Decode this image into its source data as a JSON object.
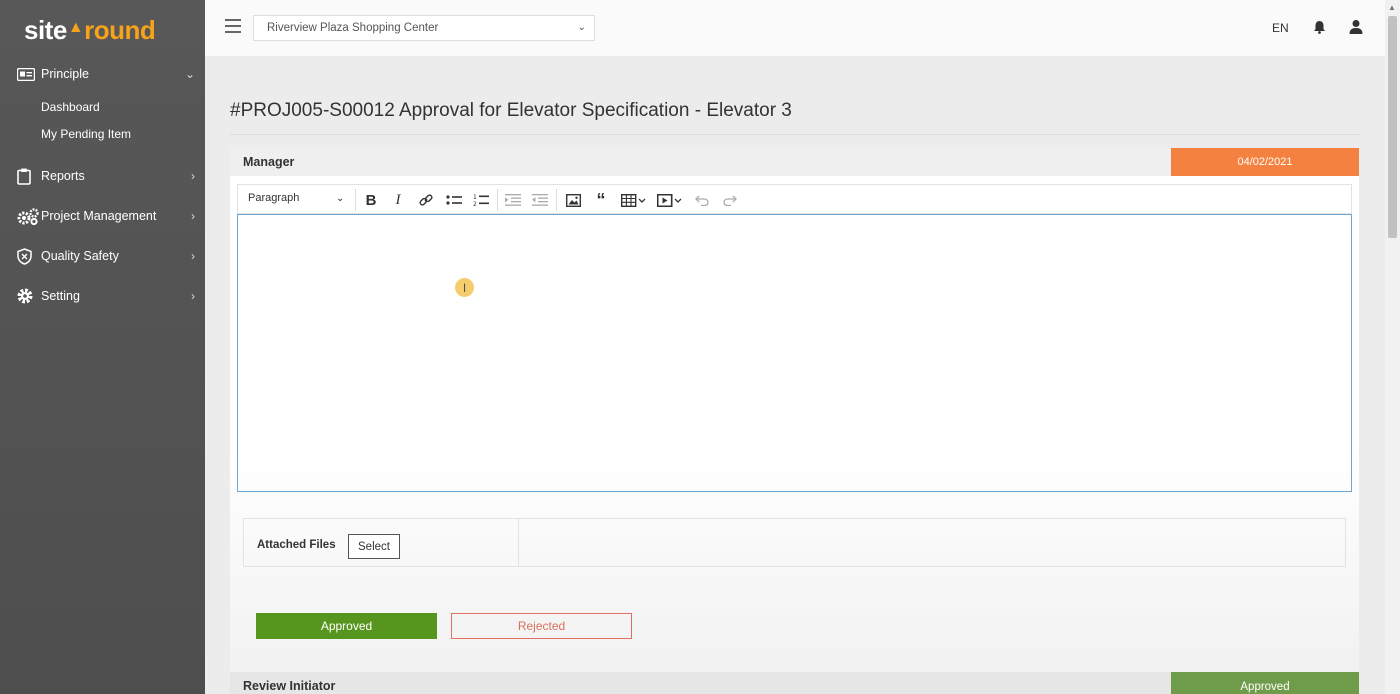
{
  "brand": {
    "part1": "site",
    "part2": "round"
  },
  "sidebar": {
    "principle": "Principle",
    "sub_items": [
      "Dashboard",
      "My Pending Item"
    ],
    "reports": "Reports",
    "project_management": "Project Management",
    "quality_safety": "Quality Safety",
    "setting": "Setting"
  },
  "topbar": {
    "project": "Riverview Plaza Shopping Center",
    "language": "EN"
  },
  "page": {
    "title": "#PROJ005-S00012 Approval for Elevator Specification - Elevator 3"
  },
  "manager_section": {
    "label": "Manager",
    "date": "04/02/2021",
    "editor": {
      "paragraph_style": "Paragraph"
    },
    "attached_files_label": "Attached Files",
    "select_label": "Select",
    "approved_label": "Approved",
    "rejected_label": "Rejected"
  },
  "review_section": {
    "label": "Review Initiator",
    "status": "Approved"
  },
  "colors": {
    "accent": "#f7a21b",
    "date_badge": "#f4813f",
    "approve": "#57961e",
    "reject": "#e07062",
    "status_approved": "#6f9c4a"
  }
}
